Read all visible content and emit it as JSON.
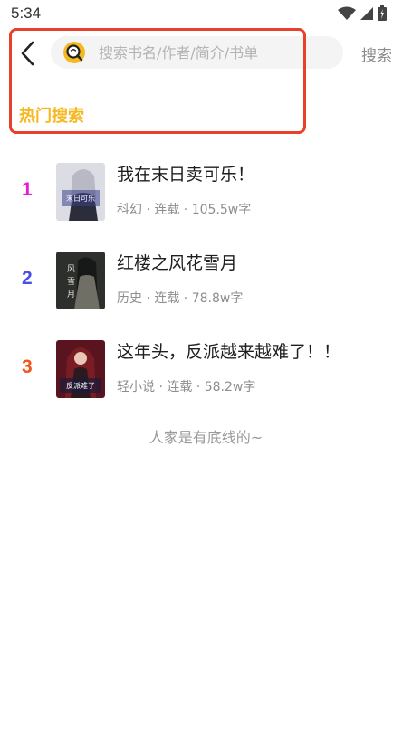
{
  "status_bar": {
    "time": "5:34",
    "icons": [
      "wifi-icon",
      "signal-icon",
      "battery-icon"
    ]
  },
  "header": {
    "back_icon": "back-arrow-icon",
    "search": {
      "placeholder": "搜索书名/作者/简介/书单",
      "value": "",
      "icon": "search-logo-icon"
    },
    "search_button_label": "搜索"
  },
  "hot_search": {
    "title": "热门搜索",
    "items": [
      {
        "rank": "1",
        "rank_color": "#e51ed6",
        "title": "我在末日卖可乐！",
        "meta": "科幻 · 连载 · 105.5w字",
        "cover_text": "我在末日卖可乐"
      },
      {
        "rank": "2",
        "rank_color": "#4a4ee8",
        "title": "红楼之风花雪月",
        "meta": "历史 · 连载 · 78.8w字",
        "cover_text": "风花雪月"
      },
      {
        "rank": "3",
        "rank_color": "#f2541d",
        "title": "这年头，反派越来越难了！！",
        "meta": "轻小说 · 连载 · 58.2w字",
        "cover_text": "这年头反派越来越难了"
      }
    ]
  },
  "footer_note": "人家是有底线的~",
  "colors": {
    "accent": "#f6b820",
    "highlight": "#e8402a"
  }
}
